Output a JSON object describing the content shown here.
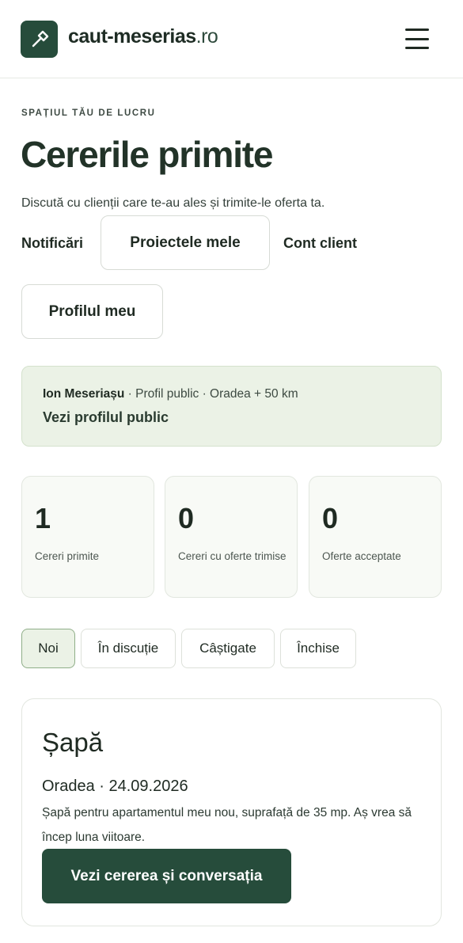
{
  "header": {
    "logo_name": "caut-meserias",
    "logo_tld": ".ro",
    "logo_icon": "hammer-icon",
    "menu_icon": "hamburger-menu-icon"
  },
  "page": {
    "kicker": "SPAȚIUL TĂU DE LUCRU",
    "title": "Cererile primite",
    "subtitle": "Discută cu clienții care te-au ales și trimite-le oferta ta."
  },
  "nav": {
    "notifications": "Notificări",
    "my_projects": "Proiectele mele",
    "client_account": "Cont client",
    "my_profile": "Profilul meu"
  },
  "profile": {
    "name": "Ion Meseriașu",
    "details": " · Profil public · Oradea + 50 km",
    "link": "Vezi profilul public"
  },
  "stats": [
    {
      "value": "1",
      "label": "Cereri primite"
    },
    {
      "value": "0",
      "label": "Cereri cu oferte trimise"
    },
    {
      "value": "0",
      "label": "Oferte acceptate"
    }
  ],
  "tabs": [
    {
      "label": "Noi",
      "active": true
    },
    {
      "label": "În discuție",
      "active": false
    },
    {
      "label": "Câștigate",
      "active": false
    },
    {
      "label": "Închise",
      "active": false
    }
  ],
  "request": {
    "title": "Șapă",
    "meta": "Oradea · 24.09.2026",
    "description": "Șapă pentru apartamentul meu nou, suprafață de 35 mp. Aș vrea să încep luna viitoare.",
    "button": "Vezi cererea și conversația"
  },
  "colors": {
    "brand": "#264c3b",
    "banner_bg": "#ebf2e6",
    "card_bg": "#f8faf6"
  }
}
